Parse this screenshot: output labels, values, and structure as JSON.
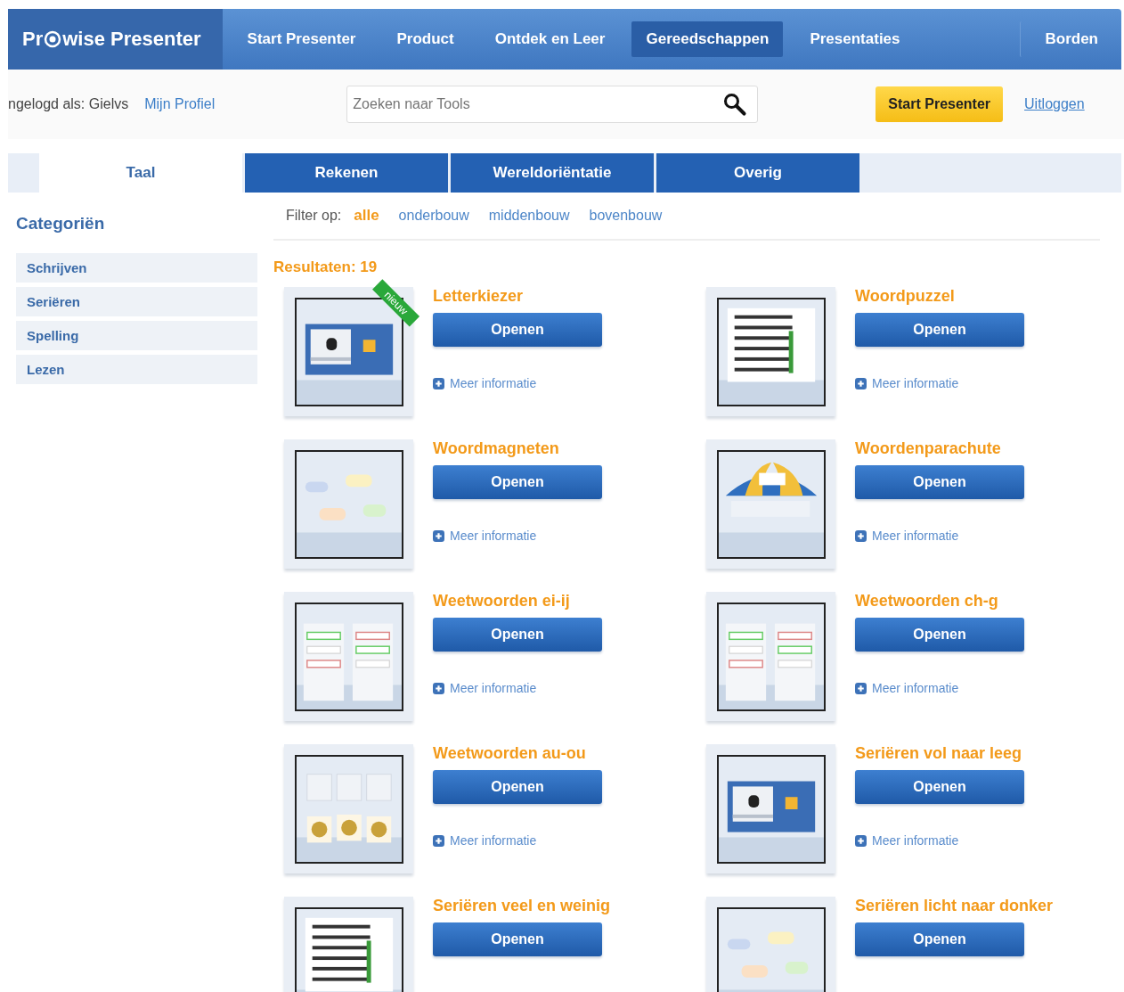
{
  "logo": {
    "before": "Pr",
    "after": "wise Presenter"
  },
  "nav": [
    {
      "label": "Start Presenter",
      "selected": false
    },
    {
      "label": "Product",
      "selected": false
    },
    {
      "label": "Ontdek en Leer",
      "selected": false
    },
    {
      "label": "Gereedschappen",
      "selected": true
    },
    {
      "label": "Presentaties",
      "selected": false
    },
    {
      "label": "Borden",
      "selected": false
    }
  ],
  "user_bar": {
    "logged_in": "ngelogd als: Gielvs",
    "profile_link": "Mijn Profiel",
    "search": {
      "placeholder": "Zoeken naar Tools"
    },
    "start_button": "Start Presenter",
    "logout_link": "Uitloggen"
  },
  "tabs": [
    {
      "label": "Taal",
      "selected": true
    },
    {
      "label": "Rekenen",
      "selected": false
    },
    {
      "label": "Wereldoriëntatie",
      "selected": false
    },
    {
      "label": "Overig",
      "selected": false
    }
  ],
  "sidebar": {
    "title": "Categoriën",
    "items": [
      "Schrijven",
      "Seriëren",
      "Spelling",
      "Lezen"
    ]
  },
  "filter": {
    "label": "Filter op:",
    "options": [
      {
        "label": "alle",
        "selected": true
      },
      {
        "label": "onderbouw",
        "selected": false
      },
      {
        "label": "middenbouw",
        "selected": false
      },
      {
        "label": "bovenbouw",
        "selected": false
      }
    ]
  },
  "results": "Resultaten: 19",
  "tools": [
    {
      "title": "Letterkiezer",
      "badge": "nieuw",
      "button": "Openen",
      "info": "Meer informatie"
    },
    {
      "title": "Woordpuzzel",
      "button": "Openen",
      "info": "Meer informatie"
    },
    {
      "title": "Woordmagneten",
      "button": "Openen",
      "info": "Meer informatie"
    },
    {
      "title": "Woordenparachute",
      "button": "Openen",
      "info": "Meer informatie"
    },
    {
      "title": "Weetwoorden ei-ij",
      "button": "Openen",
      "info": "Meer informatie"
    },
    {
      "title": "Weetwoorden ch-g",
      "button": "Openen",
      "info": "Meer informatie"
    },
    {
      "title": "Weetwoorden au-ou",
      "button": "Openen",
      "info": "Meer informatie"
    },
    {
      "title": "Seriëren vol naar leeg",
      "button": "Openen",
      "info": "Meer informatie"
    },
    {
      "title": "Seriëren veel en weinig",
      "button": "Openen"
    },
    {
      "title": "Seriëren licht naar donker",
      "button": "Openen"
    }
  ]
}
